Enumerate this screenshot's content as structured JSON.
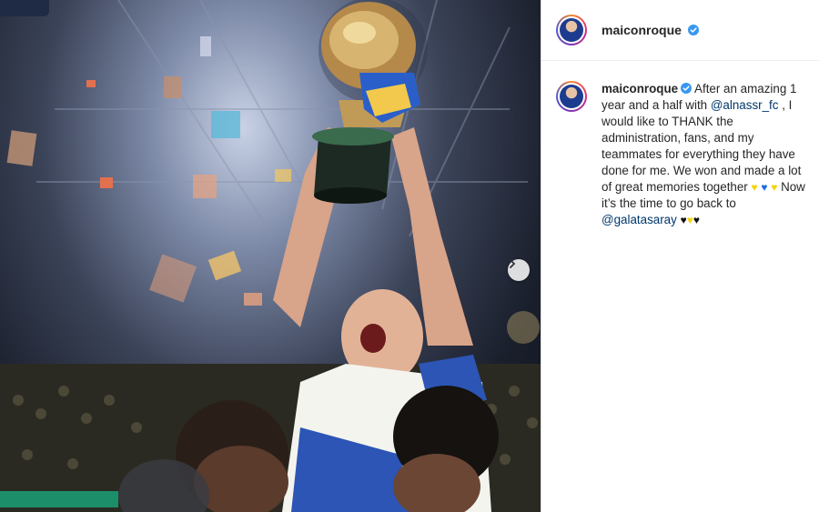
{
  "post": {
    "username": "maiconroque",
    "caption": {
      "username": "maiconroque",
      "part1": " After an amazing 1 year and a half with ",
      "mention1": "@alnassr_fc",
      "part2": " , I would like to THANK the administration, fans, and my teammates for everything they have done for me. We won and made a lot of great memories together ",
      "part3": " Now it’s the time to go back to ",
      "mention2": "@galatasaray",
      "hearts1": [
        "♥",
        "♥",
        "♥"
      ],
      "hearts2": [
        "♥",
        "♥",
        "♥"
      ]
    }
  },
  "icons": {
    "verified": "verified-badge-icon",
    "next": "chevron-right-icon"
  },
  "colors": {
    "mention": "#00376b",
    "verified": "#3897f0",
    "heart_yellow": "#f2d60f",
    "heart_blue": "#1b6fd8",
    "heart_black": "#111111"
  }
}
